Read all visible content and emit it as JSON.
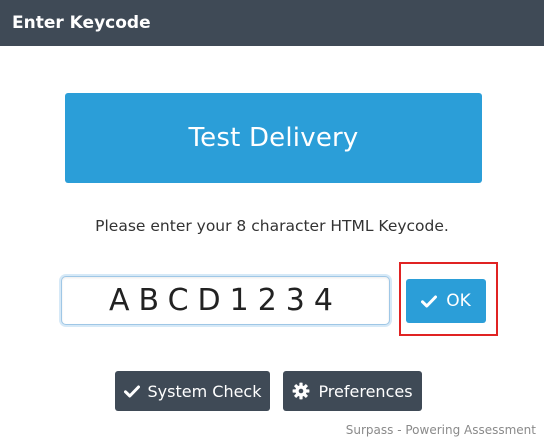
{
  "window": {
    "title": "Enter Keycode"
  },
  "banner": {
    "title": "Test Delivery"
  },
  "instruction": {
    "text": "Please enter your 8 character HTML Keycode."
  },
  "keycode_field": {
    "value": "ABCD1234"
  },
  "ok_button": {
    "label": "OK",
    "icon": "checkmark-icon"
  },
  "system_check_button": {
    "label": "System Check",
    "icon": "checkmark-icon"
  },
  "preferences_button": {
    "label": "Preferences",
    "icon": "gear-icon"
  },
  "footer": {
    "text": "Surpass - Powering Assessment"
  },
  "colors": {
    "titlebar": "#3f4a56",
    "accent": "#2b9ed8",
    "highlight": "#e02323"
  }
}
